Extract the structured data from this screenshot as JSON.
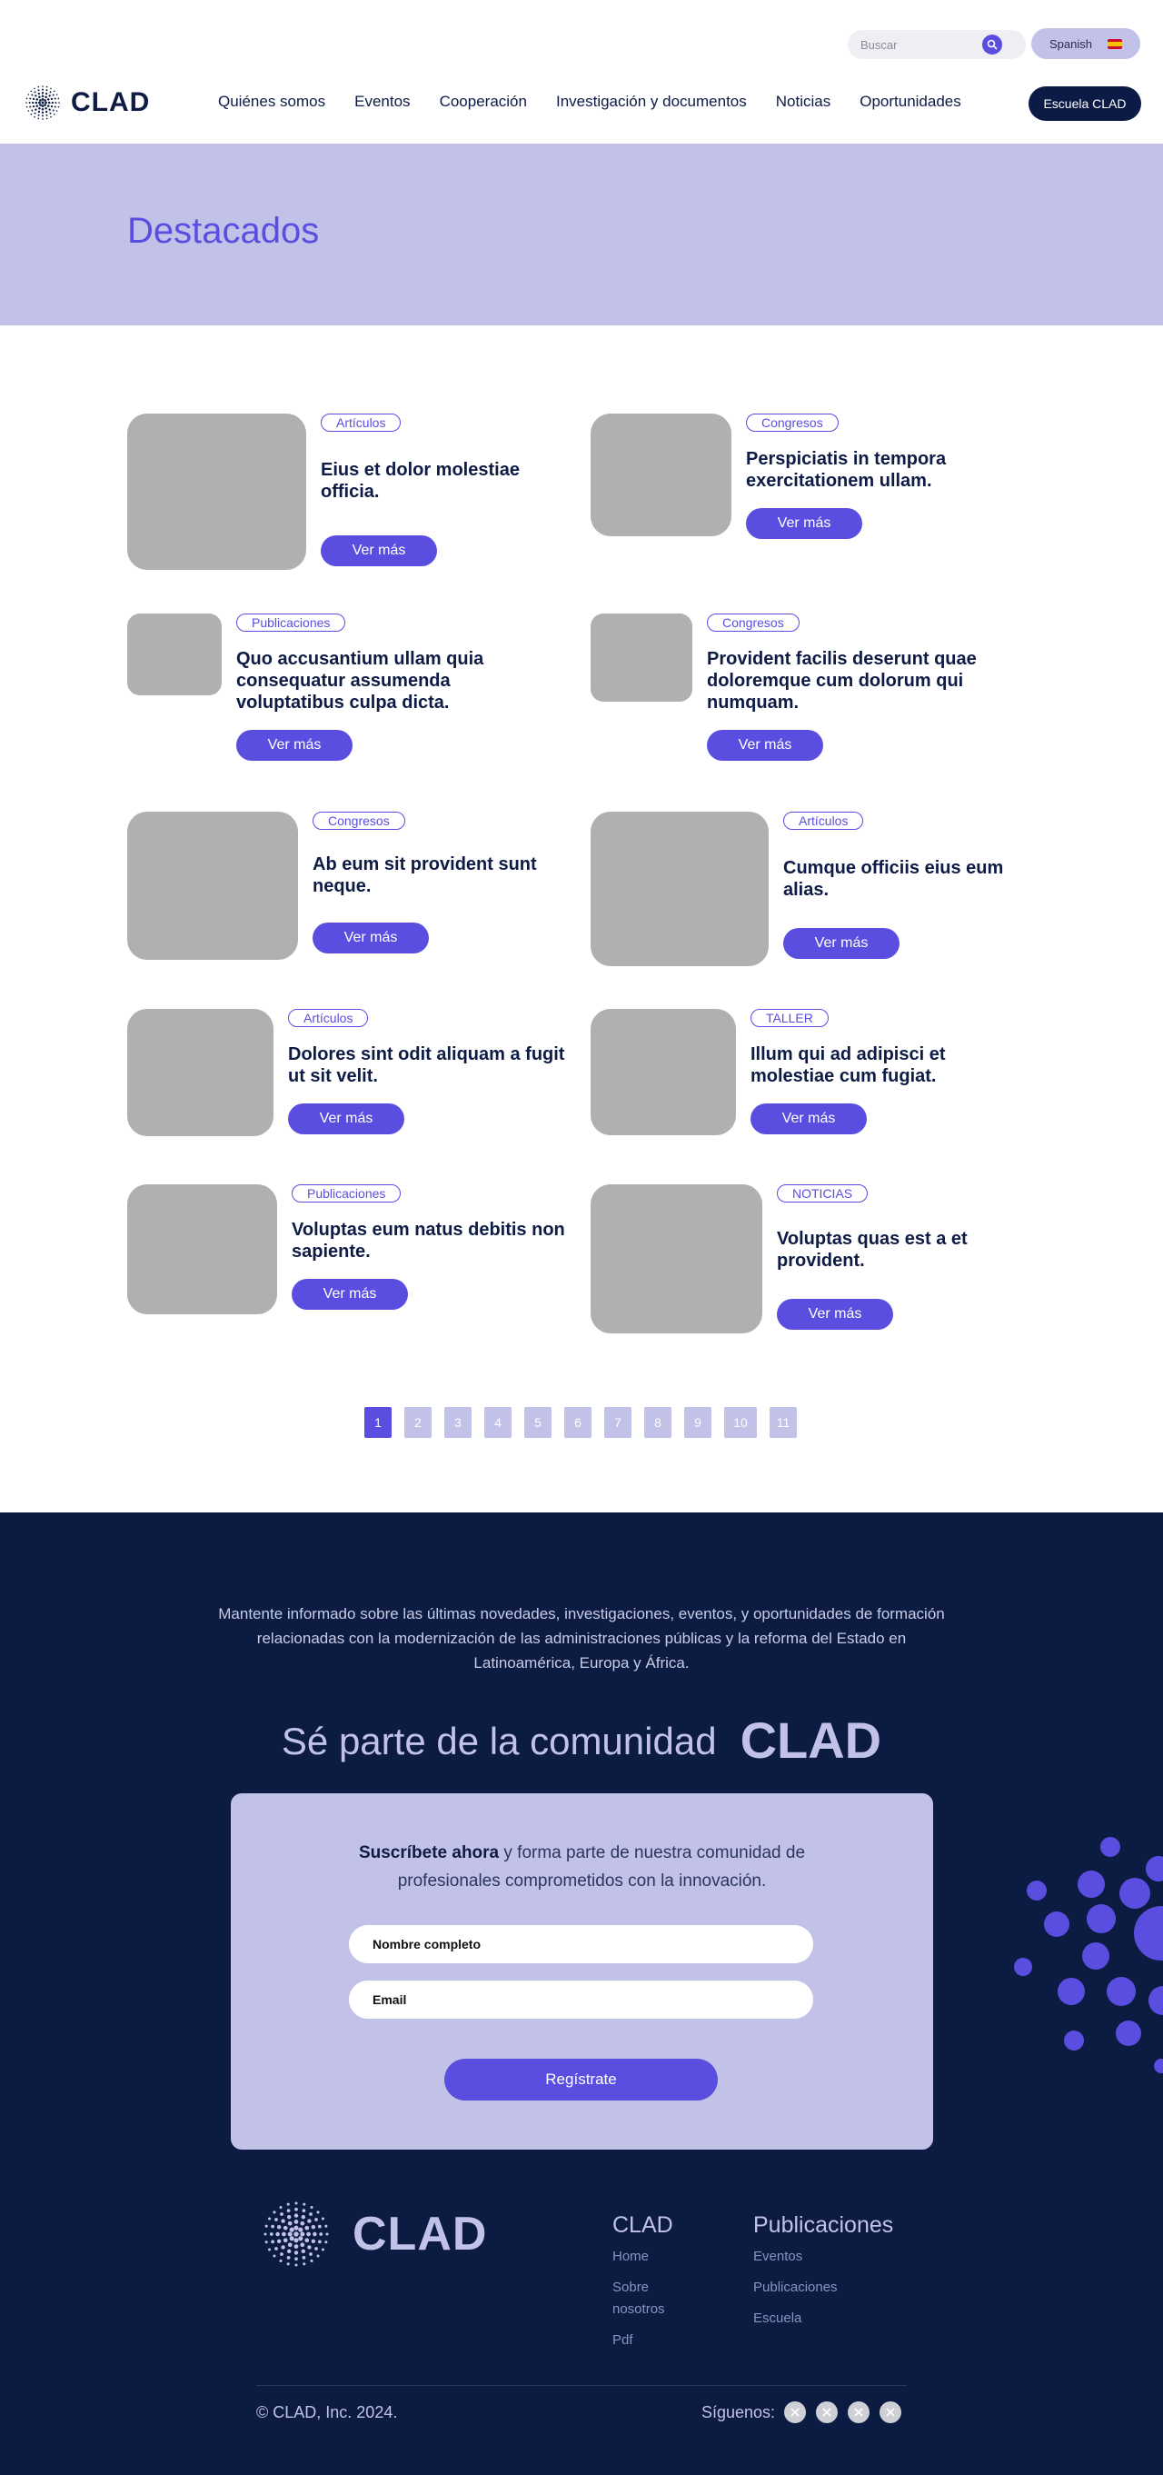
{
  "header": {
    "search_placeholder": "Buscar",
    "language": "Spanish",
    "logo": "CLAD",
    "nav": [
      "Quiénes somos",
      "Eventos",
      "Cooperación",
      "Investigación y documentos",
      "Noticias",
      "Oportunidades"
    ],
    "cta": "Escuela CLAD"
  },
  "hero": {
    "title": "Destacados"
  },
  "cards": [
    {
      "tag": "Artículos",
      "title": "Eius et dolor molestiae officia.",
      "button": "Ver más"
    },
    {
      "tag": "Congresos",
      "title": "Perspiciatis in tempora exercitationem ullam.",
      "button": "Ver más"
    },
    {
      "tag": "Publicaciones",
      "title": "Quo accusantium ullam quia consequatur assumenda voluptatibus culpa dicta.",
      "button": "Ver más"
    },
    {
      "tag": "Congresos",
      "title": "Provident facilis deserunt quae doloremque cum dolorum qui numquam.",
      "button": "Ver más"
    },
    {
      "tag": "Congresos",
      "title": "Ab eum sit provident sunt neque.",
      "button": "Ver más"
    },
    {
      "tag": "Artículos",
      "title": "Cumque officiis eius eum alias.",
      "button": "Ver más"
    },
    {
      "tag": "Artículos",
      "title": "Dolores sint odit aliquam a fugit ut sit velit.",
      "button": "Ver más"
    },
    {
      "tag": "TALLER",
      "title": "Illum qui ad adipisci et molestiae cum fugiat.",
      "button": "Ver más"
    },
    {
      "tag": "Publicaciones",
      "title": "Voluptas eum natus debitis non sapiente.",
      "button": "Ver más"
    },
    {
      "tag": "NOTICIAS",
      "title": "Voluptas quas est a et provident.",
      "button": "Ver más"
    }
  ],
  "pagination": {
    "pages": [
      "1",
      "2",
      "3",
      "4",
      "5",
      "6",
      "7",
      "8",
      "9",
      "10",
      "11"
    ],
    "current": "1"
  },
  "footer": {
    "intro": "Mantente informado sobre las últimas novedades, investigaciones, eventos, y oportunidades de formación relacionadas con la modernización de las administraciones públicas y la reforma del Estado en Latinoamérica, Europa y África.",
    "join_text": "Sé parte de la comunidad",
    "join_brand": "CLAD",
    "subscribe_bold": "Suscríbete ahora",
    "subscribe_rest": " y forma parte de nuestra comunidad de profesionales comprometidos con la innovación.",
    "name_placeholder": "Nombre completo",
    "email_placeholder": "Email",
    "register": "Regístrate",
    "logo": "CLAD",
    "col1_title": "CLAD",
    "col1_links": [
      "Home",
      "Sobre nosotros",
      "Pdf"
    ],
    "col2_title": "Publicaciones",
    "col2_links": [
      "Eventos",
      "Publicaciones",
      "Escuela"
    ],
    "copyright": "© CLAD, Inc. 2024.",
    "follow": "Síguenos:",
    "social_icons": [
      "x-icon",
      "x-icon",
      "x-icon",
      "x-icon"
    ]
  },
  "colors": {
    "accent": "#5a4ee0",
    "lavender": "#c2c2e8",
    "navy": "#0b1b42",
    "placeholder": "#b0b0b0"
  }
}
